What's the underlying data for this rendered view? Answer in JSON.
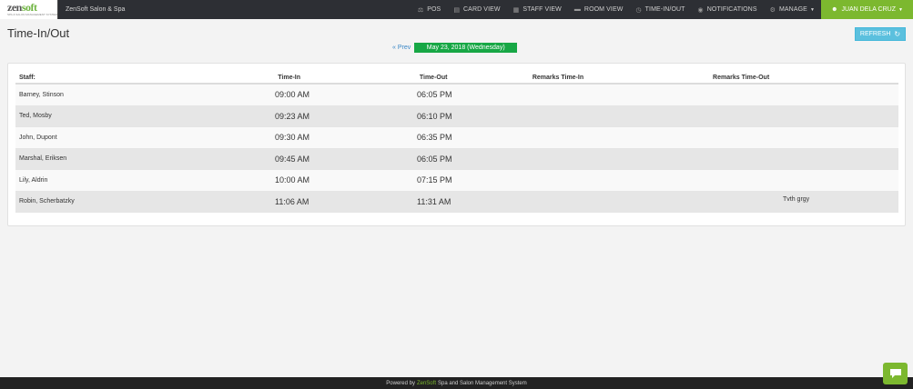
{
  "navbar": {
    "logo_text_a": "zen",
    "logo_text_b": "soft",
    "logo_tagline": "SPA & SALON MANAGEMENT SYSTEM",
    "shop_name": "ZenSoft Salon & Spa",
    "items": [
      {
        "label": "POS",
        "icon": "scale-icon"
      },
      {
        "label": "CARD VIEW",
        "icon": "card-icon"
      },
      {
        "label": "STAFF VIEW",
        "icon": "calendar-icon"
      },
      {
        "label": "ROOM VIEW",
        "icon": "bed-icon"
      },
      {
        "label": "TIME-IN/OUT",
        "icon": "clock-icon"
      },
      {
        "label": "NOTIFICATIONS",
        "icon": "bell-icon"
      },
      {
        "label": "MANAGE",
        "icon": "gear-icon"
      }
    ],
    "user": "JUAN DELA CRUZ",
    "accent_color": "#7cb82f",
    "bg_color": "#2d2f34"
  },
  "page": {
    "title": "Time-In/Out",
    "prev_label": "« Prev",
    "date_label": "May 23, 2018 (Wednesday)",
    "date_badge_color": "#17a745",
    "refresh_label": "REFRESH"
  },
  "table": {
    "headers": {
      "staff": "Staff:",
      "time_in": "Time-In",
      "time_out": "Time-Out",
      "remarks_in": "Remarks Time-In",
      "remarks_out": "Remarks Time-Out"
    },
    "rows": [
      {
        "staff": "Barney, Stinson",
        "time_in": "09:00 AM",
        "time_out": "06:05 PM",
        "remarks_in": "",
        "remarks_out": ""
      },
      {
        "staff": "Ted, Mosby",
        "time_in": "09:23 AM",
        "time_out": "06:10 PM",
        "remarks_in": "",
        "remarks_out": ""
      },
      {
        "staff": "John, Dupont",
        "time_in": "09:30 AM",
        "time_out": "06:35 PM",
        "remarks_in": "",
        "remarks_out": ""
      },
      {
        "staff": "Marshal, Eriksen",
        "time_in": "09:45 AM",
        "time_out": "06:05 PM",
        "remarks_in": "",
        "remarks_out": ""
      },
      {
        "staff": "Lily, Aldrin",
        "time_in": "10:00 AM",
        "time_out": "07:15 PM",
        "remarks_in": "",
        "remarks_out": ""
      },
      {
        "staff": "Robin, Scherbatzky",
        "time_in": "11:06 AM",
        "time_out": "11:31 AM",
        "remarks_in": "",
        "remarks_out": "Tvth grgy"
      }
    ]
  },
  "footer": {
    "prefix": "Powered by",
    "brand": "ZenSoft",
    "suffix": "Spa and Salon Management System"
  }
}
